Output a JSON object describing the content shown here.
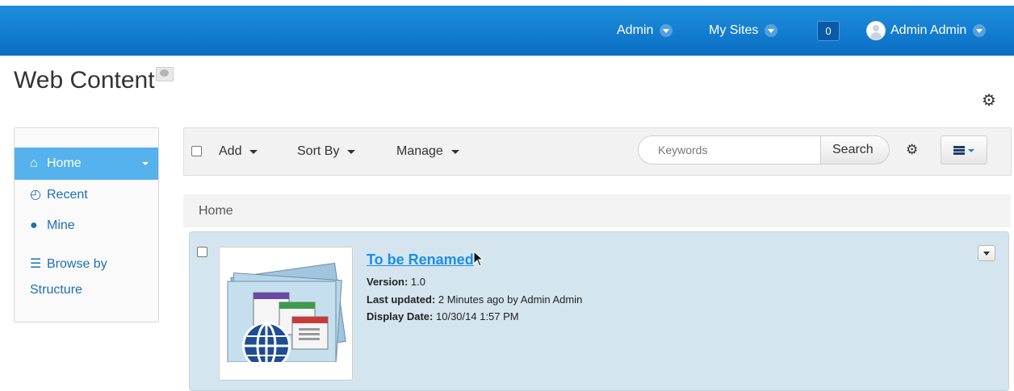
{
  "dockbar": {
    "admin_label": "Admin",
    "my_sites_label": "My Sites",
    "notification_count": "0",
    "user_name": "Admin Admin"
  },
  "page": {
    "title": "Web Content"
  },
  "nav": {
    "items": [
      {
        "label": "Home",
        "icon": "home-icon"
      },
      {
        "label": "Recent",
        "icon": "clock-icon"
      },
      {
        "label": "Mine",
        "icon": "user-icon"
      },
      {
        "label": "Browse by",
        "label2": "Structure",
        "icon": "list-icon"
      }
    ]
  },
  "toolbar": {
    "add_label": "Add",
    "sort_label": "Sort By",
    "manage_label": "Manage",
    "search_placeholder": "Keywords",
    "search_label": "Search"
  },
  "breadcrumb": {
    "home": "Home"
  },
  "entry": {
    "title": "To be Renamed",
    "version_label": "Version:",
    "version_value": "1.0",
    "updated_label": "Last updated:",
    "updated_value": "2 Minutes ago by Admin Admin",
    "display_label": "Display Date:",
    "display_value": "10/30/14 1:57 PM"
  },
  "colors": {
    "dockbar": "#0a6ec4",
    "active_nav": "#55b2ec",
    "link": "#1b8ee6",
    "entry_bg": "#d4e5ef"
  }
}
